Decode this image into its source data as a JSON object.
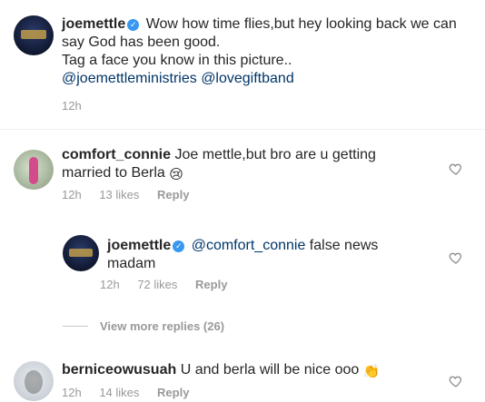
{
  "post": {
    "username": "joemettle",
    "verified": true,
    "line1": "Wow how time flies,but hey looking back we can",
    "line2": "say God has been good.",
    "line3": "Tag a face you know in this picture..",
    "mention1": "@joemettleministries",
    "mention2": "@lovegiftband",
    "time": "12h"
  },
  "comments": [
    {
      "username": "comfort_connie",
      "text_line1": "Joe mettle,but bro are u getting",
      "text_line2": "married to Berla",
      "emoji": "😢",
      "time": "12h",
      "likes": "13 likes",
      "reply": "Reply"
    },
    {
      "username": "joemettle",
      "verified": true,
      "mention": "@comfort_connie",
      "text_line1": "false news",
      "text_line2": "madam",
      "time": "12h",
      "likes": "72 likes",
      "reply": "Reply"
    },
    {
      "username": "berniceowusuah",
      "text_line1": "U and berla will be nice ooo",
      "emoji": "👏",
      "time": "12h",
      "likes": "14 likes",
      "reply": "Reply"
    }
  ],
  "view_more": "View more replies (26)",
  "icons": {
    "heart": "heart-outline-icon",
    "verified": "verified-badge-icon"
  },
  "colors": {
    "verified": "#3897f0",
    "mention": "#003569",
    "meta": "#999999"
  }
}
